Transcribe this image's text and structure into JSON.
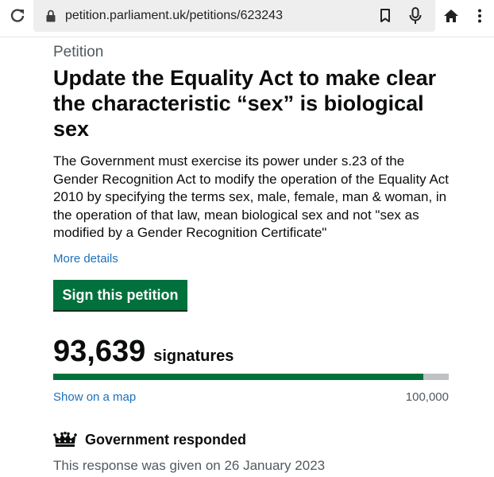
{
  "browser": {
    "url": "petition.parliament.uk/petitions/623243",
    "icons": {
      "reload": "reload-icon",
      "lock": "lock-icon",
      "bookmark": "bookmark-icon",
      "mic": "microphone-icon",
      "home": "home-icon",
      "menu": "kebab-menu-icon"
    }
  },
  "petition": {
    "caption": "Petition",
    "title": "Update the Equality Act to make clear the characteristic “sex” is biological sex",
    "summary": "The Government must exercise its power under s.23 of the Gender Recognition Act to modify the operation of the Equality Act 2010 by specifying the terms sex, male, female, man & woman, in the operation of that law, mean biological sex and not \"sex as modified by a Gender Recognition Certificate\"",
    "more_details_label": "More details",
    "sign_button_label": "Sign this petition"
  },
  "signatures": {
    "count": "93,639",
    "label": "signatures",
    "target": "100,000",
    "progress_fraction": 0.93639,
    "show_map_label": "Show on a map"
  },
  "response": {
    "heading": "Government responded",
    "date_text": "This response was given on 26 January 2023",
    "icon": "crown-icon"
  },
  "colors": {
    "button": "#00703c",
    "link": "#1d70b8",
    "progress_fill": "#00703c",
    "progress_track": "#bfc1c3",
    "secondary_text": "#505a5f"
  }
}
